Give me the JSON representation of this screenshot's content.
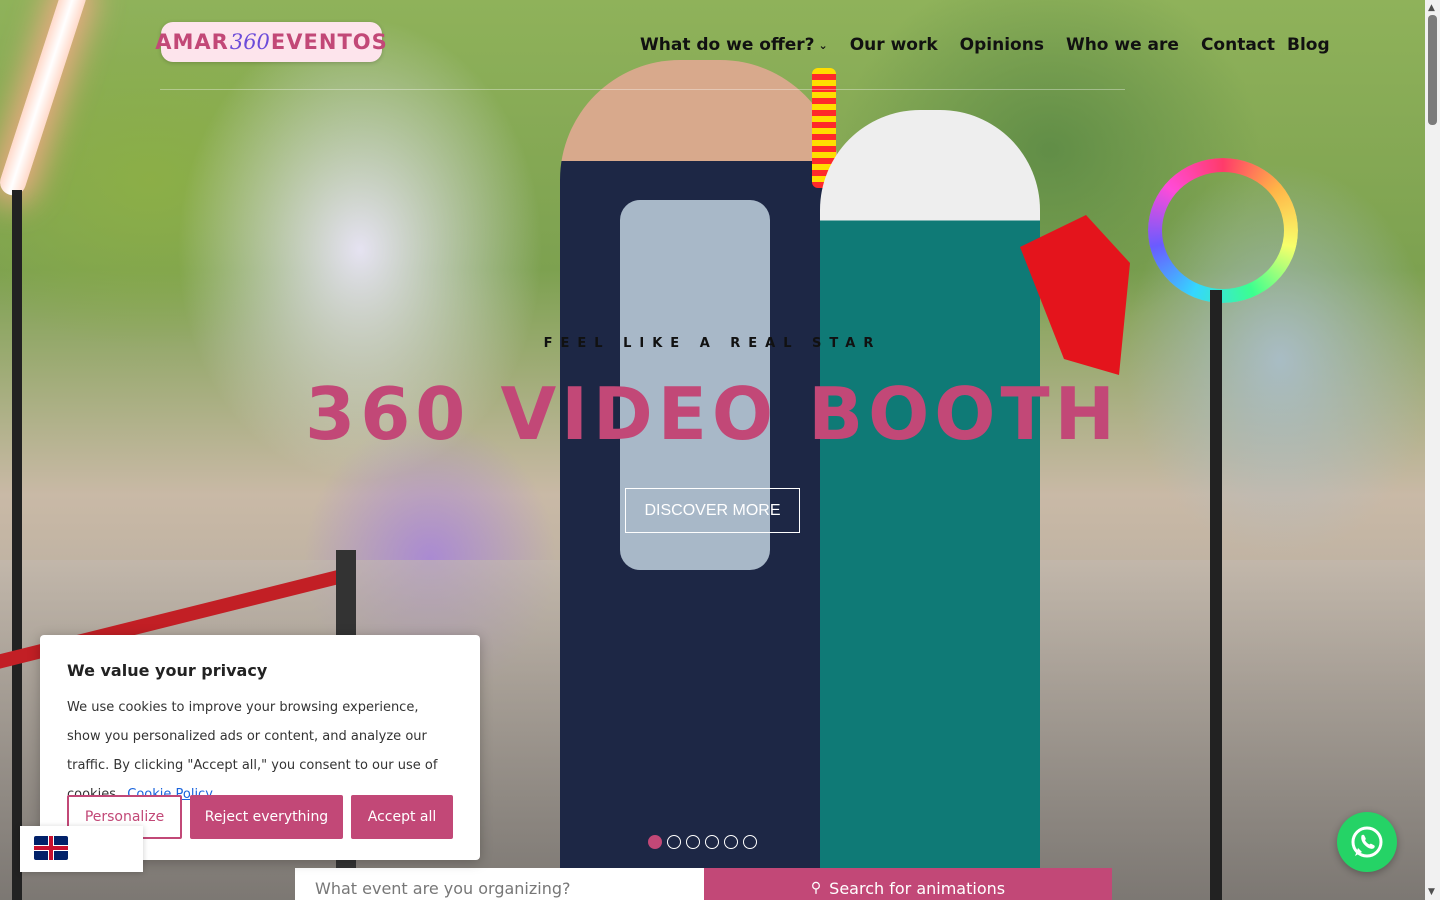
{
  "header": {
    "logo": {
      "part1": "AMAR",
      "part2": "360",
      "part3": "EVENTOS"
    },
    "nav": [
      {
        "label": "What do we offer?",
        "has_dropdown": true
      },
      {
        "label": "Our work"
      },
      {
        "label": "Opinions"
      },
      {
        "label": "Who we are"
      },
      {
        "label": "Contact"
      },
      {
        "label": "Blog"
      }
    ]
  },
  "hero": {
    "tagline": "FEEL LIKE A REAL STAR",
    "headline": "360 VIDEO BOOTH",
    "cta_label": "DISCOVER MORE",
    "slides_total": 6,
    "active_slide": 1
  },
  "search": {
    "placeholder": "What event are you organizing?",
    "button_label": "Search for animations",
    "button_icon": "search-icon"
  },
  "cookie_banner": {
    "title": "We value your privacy",
    "text": "We use cookies to improve your browsing experience, show you personalized ads or content, and analyze our traffic. By clicking \"Accept all,\" you consent to our use of cookies.",
    "link_label": "Cookie Policy",
    "buttons": {
      "personalize": "Personalize",
      "reject": "Reject everything",
      "accept": "Accept all"
    }
  },
  "language": {
    "icon": "uk-flag-icon"
  },
  "whatsapp": {
    "icon": "whatsapp-icon"
  },
  "colors": {
    "accent": "#c24877",
    "logo_bg": "#fde4ec",
    "whatsapp": "#25d366",
    "link": "#1863dc"
  }
}
